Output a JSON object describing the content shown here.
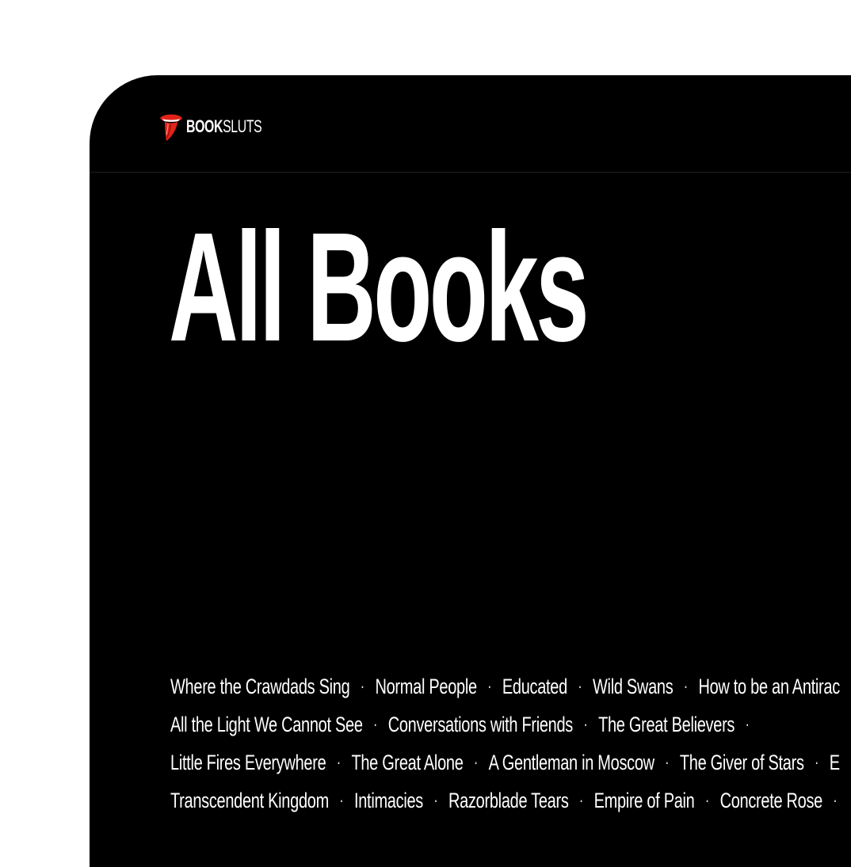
{
  "brand": {
    "name_bold": "BOOK",
    "name_light": "SLUTS",
    "logo_icon": "rolling-stones-tongue-icon",
    "accent_color": "#e2231a"
  },
  "page": {
    "title": "All Books",
    "background": "#000000",
    "text_color": "#ffffff"
  },
  "separator": "·",
  "book_rows": [
    [
      "Where the Crawdads Sing",
      "Normal People",
      "Educated",
      "Wild Swans",
      "How to be an Antirac"
    ],
    [
      "All the Light We Cannot See",
      "Conversations with Friends",
      "The Great Believers",
      ""
    ],
    [
      "Little Fires Everywhere",
      "The Great Alone",
      "A Gentleman in Moscow",
      "The Giver of Stars",
      "E"
    ],
    [
      "Transcendent Kingdom",
      "Intimacies",
      "Razorblade Tears",
      "Empire of Pain",
      "Concrete Rose",
      ""
    ]
  ]
}
